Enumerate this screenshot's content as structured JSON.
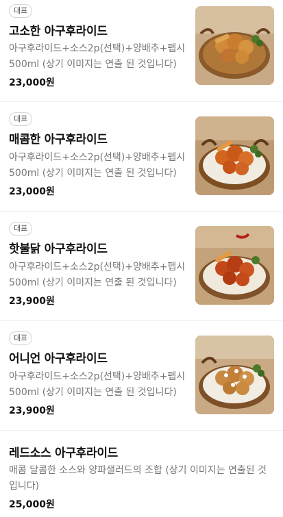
{
  "menu": {
    "items": [
      {
        "badge": "대표",
        "name": "고소한 아구후라이드",
        "description": "아구후라이드+소스2p(선택)+양배추+펩시500ml (상기 이미지는 연출 된 것입니다)",
        "price": "23,000원",
        "image": "fried-chicken-basket-photo"
      },
      {
        "badge": "대표",
        "name": "매콤한 아구후라이드",
        "description": "아구후라이드+소스2p(선택)+양배추+펩시500ml (상기 이미지는 연출 된 것입니다)",
        "price": "23,000원",
        "image": "spicy-fried-chicken-basket-photo"
      },
      {
        "badge": "대표",
        "name": "핫불닭 아구후라이드",
        "description": "아구후라이드+소스2p(선택)+양배추+펩시500ml (상기 이미지는 연출 된 것입니다)",
        "price": "23,900원",
        "image": "hot-buldak-fried-chicken-basket-photo"
      },
      {
        "badge": "대표",
        "name": "어니언 아구후라이드",
        "description": "아구후라이드+소스2p(선택)+양배추+펩시500ml (상기 이미지는 연출 된 것입니다)",
        "price": "23,900원",
        "image": "onion-fried-chicken-basket-photo"
      },
      {
        "name": "레드소스 아구후라이드",
        "description": "매콤 달콤한 소스와 양파샐러드의 조합 (상기 이미지는 연출된 것입니다)",
        "price": "25,000원"
      }
    ]
  }
}
